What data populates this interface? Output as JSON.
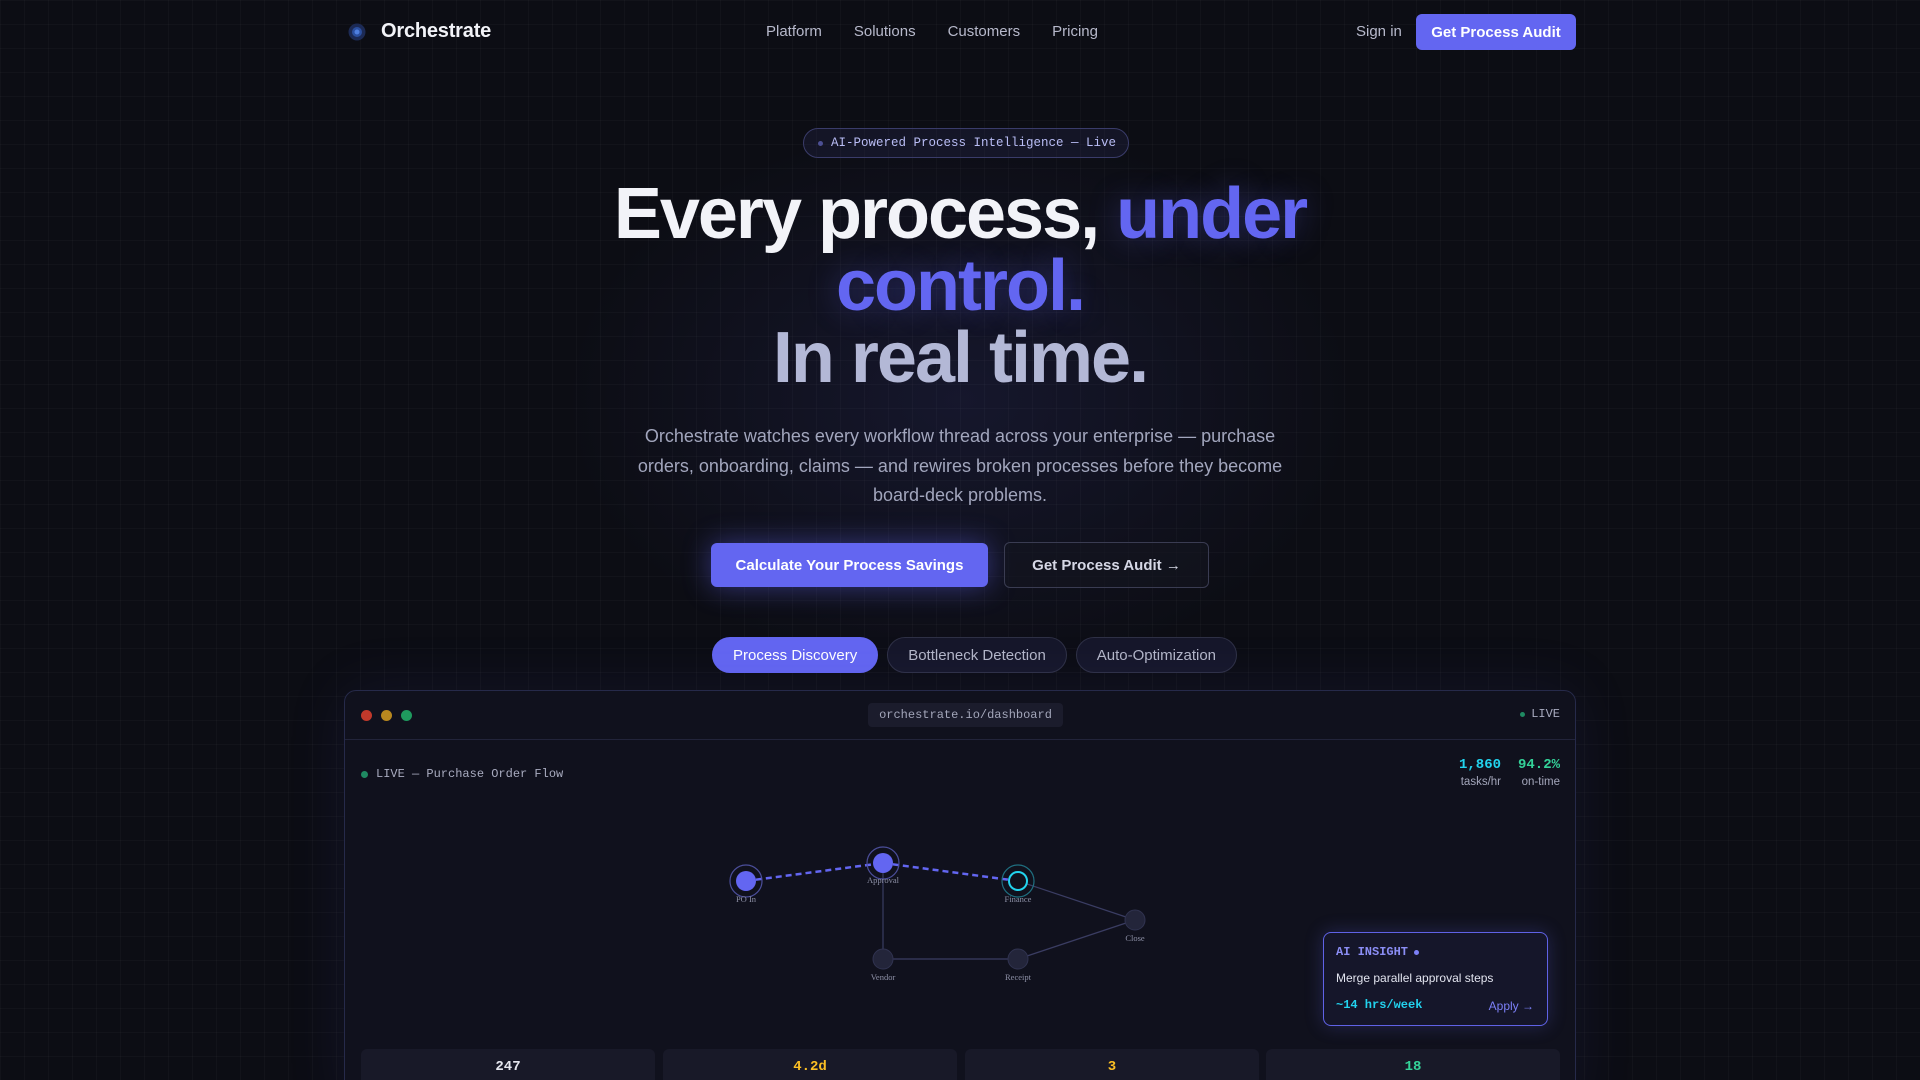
{
  "nav": {
    "brand": "Orchestrate",
    "links": [
      "Platform",
      "Solutions",
      "Customers",
      "Pricing"
    ],
    "signin": "Sign in",
    "cta": "Get Process Audit"
  },
  "hero": {
    "badge": "AI-Powered Process Intelligence — Live",
    "headline_part1": "Every process,",
    "headline_accent": "under control.",
    "headline_line3": "In real time.",
    "subtext": "Orchestrate watches every workflow thread across your enterprise — purchase orders, onboarding, claims — and rewires broken processes before they become board-deck problems.",
    "cta_primary": "Calculate Your Process Savings",
    "cta_secondary": "Get Process Audit →"
  },
  "tabs": [
    {
      "label": "Process Discovery",
      "active": true
    },
    {
      "label": "Bottleneck Detection",
      "active": false
    },
    {
      "label": "Auto-Optimization",
      "active": false
    }
  ],
  "dashboard": {
    "url": "orchestrate.io/dashboard",
    "live_badge": "LIVE",
    "flow_label": "LIVE — Purchase Order Flow",
    "stats": [
      {
        "value": "1,860",
        "label": "tasks/hr",
        "color": "#22d3ee"
      },
      {
        "value": "94.2%",
        "label": "on-time",
        "color": "#34d399"
      }
    ],
    "nodes": {
      "po_in": "PO In",
      "approval": "Approval",
      "finance": "Finance",
      "close": "Close",
      "vendor": "Vendor",
      "receipt": "Receipt"
    },
    "insight": {
      "title": "AI INSIGHT",
      "body": "Merge parallel approval steps",
      "savings": "~14 hrs/week",
      "action": "Apply →"
    },
    "kpis": [
      {
        "value": "247",
        "color": "#e6e7ef"
      },
      {
        "value": "4.2d",
        "color": "#fbbf24"
      },
      {
        "value": "3",
        "color": "#fbbf24"
      },
      {
        "value": "18",
        "color": "#34d399"
      }
    ]
  },
  "colors": {
    "accent": "#6366f1",
    "cyan": "#22d3ee",
    "green": "#34d399",
    "amber": "#fbbf24"
  }
}
